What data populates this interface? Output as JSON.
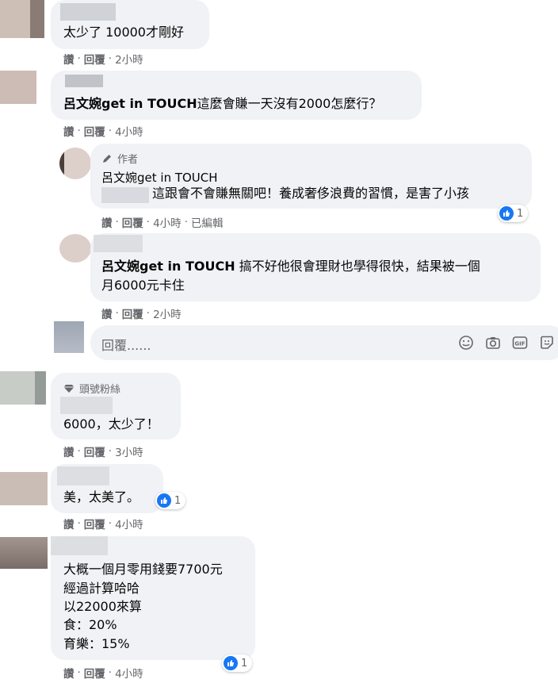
{
  "actions": {
    "like": "讚",
    "reply": "回覆",
    "dot": "·"
  },
  "comments": [
    {
      "id": "c1",
      "text": "太少了 10000才剛好",
      "time": "2小時"
    },
    {
      "id": "c2",
      "name_fragment": "呂文婉get in TOUCH",
      "text": "這麼會賺一天沒有2000怎麼行？",
      "time": "4小時"
    },
    {
      "id": "r1",
      "author_label": "作者",
      "name": "呂文婉get in TOUCH",
      "text": "這跟會不會賺無關吧！養成奢侈浪費的習慣，是害了小孩",
      "time": "4小時",
      "edited": "已編輯",
      "reactions": "1"
    },
    {
      "id": "r2",
      "tag": "呂文婉get in TOUCH",
      "text_line1": " 搞不好他很會理財也學得很快，結果被一個",
      "text_line2": "月6000元卡住",
      "time": "2小時"
    },
    {
      "id": "c3",
      "badge": "頭號粉絲",
      "text": "6000，太少了！",
      "time": "3小時"
    },
    {
      "id": "c4",
      "text": "美，太美了。",
      "time": "4小時",
      "reactions": "1"
    },
    {
      "id": "c5",
      "lines": [
        "大概一個月零用錢要7700元",
        "經過計算哈哈",
        "以22000來算",
        "食：20%",
        "育樂：15%"
      ],
      "time": "4小時",
      "reactions": "1"
    }
  ],
  "reply_box": {
    "placeholder": "回覆......"
  },
  "icons": [
    "smile-icon",
    "camera-icon",
    "gif-icon",
    "sticker-icon",
    "pencil-icon",
    "diamond-icon",
    "like-icon"
  ],
  "colors": {
    "bubble": "#f0f2f5",
    "meta": "#65676b",
    "like": "#1877f2"
  }
}
